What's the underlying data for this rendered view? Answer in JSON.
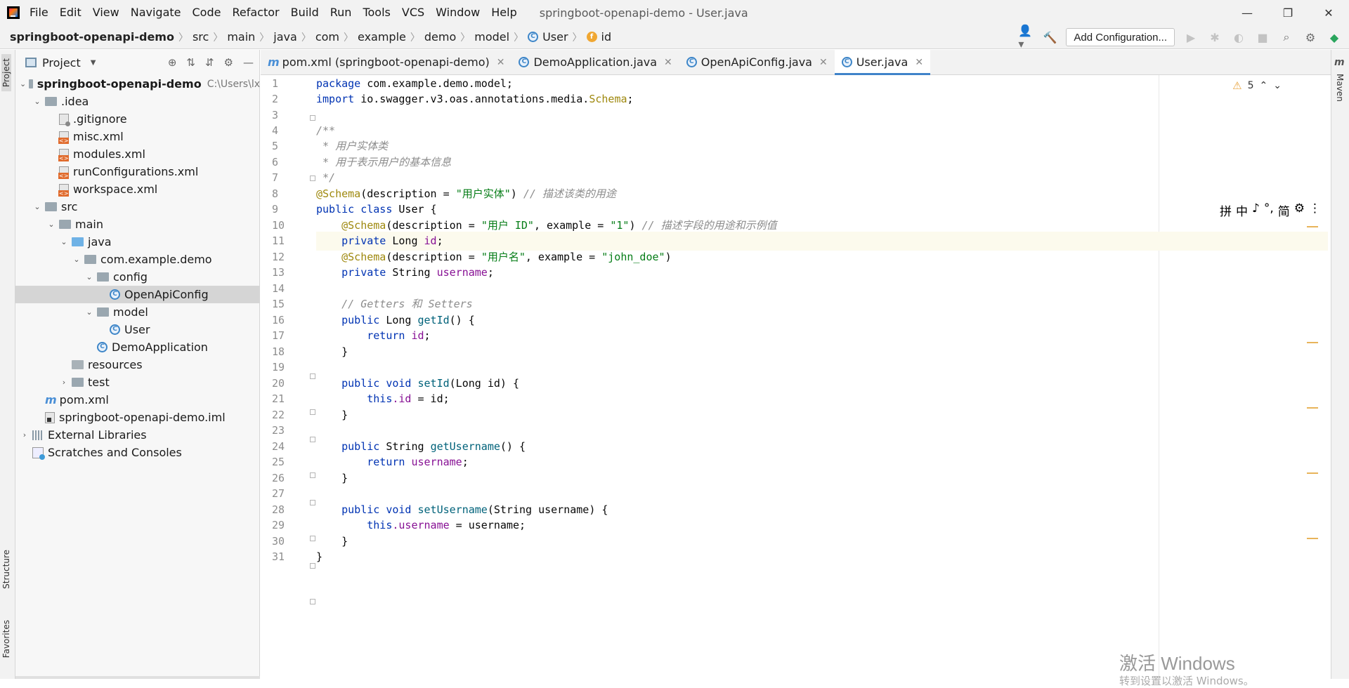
{
  "menu": [
    "File",
    "Edit",
    "View",
    "Navigate",
    "Code",
    "Refactor",
    "Build",
    "Run",
    "Tools",
    "VCS",
    "Window",
    "Help"
  ],
  "window_title": "springboot-openapi-demo - User.java",
  "breadcrumb": {
    "root": "springboot-openapi-demo",
    "parts": [
      "src",
      "main",
      "java",
      "com",
      "example",
      "demo",
      "model"
    ],
    "class": "User",
    "field": "id"
  },
  "toolbar": {
    "add_config": "Add Configuration..."
  },
  "project_panel": {
    "title": "Project",
    "root_name": "springboot-openapi-demo",
    "root_path": "C:\\Users\\lx",
    "tree": {
      "idea": ".idea",
      "gitignore": ".gitignore",
      "misc": "misc.xml",
      "modules": "modules.xml",
      "runconf": "runConfigurations.xml",
      "workspace": "workspace.xml",
      "src": "src",
      "main": "main",
      "java": "java",
      "pkg": "com.example.demo",
      "config": "config",
      "openapiconfig": "OpenApiConfig",
      "model": "model",
      "user": "User",
      "demoapp": "DemoApplication",
      "resources": "resources",
      "test": "test",
      "pom": "pom.xml",
      "iml": "springboot-openapi-demo.iml",
      "extlibs": "External Libraries",
      "scratches": "Scratches and Consoles"
    }
  },
  "tabs": [
    {
      "label": "pom.xml (springboot-openapi-demo)"
    },
    {
      "label": "DemoApplication.java"
    },
    {
      "label": "OpenApiConfig.java"
    },
    {
      "label": "User.java"
    }
  ],
  "editor": {
    "warnings": "5",
    "lines": [
      "1",
      "2",
      "3",
      "4",
      "5",
      "6",
      "7",
      "8",
      "9",
      "10",
      "11",
      "12",
      "13",
      "14",
      "15",
      "16",
      "17",
      "18",
      "19",
      "20",
      "21",
      "22",
      "23",
      "24",
      "25",
      "26",
      "27",
      "28",
      "29",
      "30",
      "31"
    ],
    "code": {
      "l1_kw": "package",
      "l1_rest": " com.example.demo.model;",
      "l2_kw": "import",
      "l2_rest": " io.swagger.v3.oas.annotations.media.",
      "l2_cls": "Schema",
      "l2_end": ";",
      "l4": "/**",
      "l5": " * 用户实体类",
      "l6": " * 用于表示用户的基本信息",
      "l7": " */",
      "l8_an": "@Schema",
      "l8_a": "(description = ",
      "l8_str": "\"用户实体\"",
      "l8_b": ") ",
      "l8_cm": "// 描述该类的用途",
      "l9_kw": "public class",
      "l9_name": " User",
      "l9_end": " {",
      "l10_an": "@Schema",
      "l10_a": "(description = ",
      "l10_str1": "\"用户 ID\"",
      "l10_b": ", example = ",
      "l10_str2": "\"1\"",
      "l10_c": ") ",
      "l10_cm": "// 描述字段的用途和示例值",
      "l11_kw": "private",
      "l11_type": " Long ",
      "l11_fld": "id",
      "l11_end": ";",
      "l12_an": "@Schema",
      "l12_a": "(description = ",
      "l12_str1": "\"用户名\"",
      "l12_b": ", example = ",
      "l12_str2": "\"john_doe\"",
      "l12_c": ")",
      "l13_kw": "private",
      "l13_type": " String ",
      "l13_fld": "username",
      "l13_end": ";",
      "l15_cm": "// Getters 和 Setters",
      "l16_kw": "public",
      "l16_type": " Long ",
      "l16_meth": "getId",
      "l16_end": "() {",
      "l17_kw": "return",
      "l17_fld": " id",
      "l17_end": ";",
      "l18": "}",
      "l20_kw": "public void",
      "l20_meth": " setId",
      "l20_end": "(Long id) {",
      "l21_kw": "this",
      "l21_fld": ".id",
      "l21_end": " = id;",
      "l22": "}",
      "l24_kw": "public",
      "l24_type": " String ",
      "l24_meth": "getUsername",
      "l24_end": "() {",
      "l25_kw": "return",
      "l25_fld": " username",
      "l25_end": ";",
      "l26": "}",
      "l28_kw": "public void",
      "l28_meth": " setUsername",
      "l28_end": "(String username) {",
      "l29_kw": "this",
      "l29_fld": ".username",
      "l29_end": " = username;",
      "l30": "}",
      "l31": "}"
    }
  },
  "ime_bar": [
    "拼",
    "中",
    "♪",
    "°,",
    "简",
    "⚙",
    "⋮"
  ],
  "side_tabs": {
    "project": "Project",
    "structure": "Structure",
    "favorites": "Favorites",
    "maven": "Maven"
  },
  "watermark": {
    "title": "激活 Windows",
    "sub": "转到设置以激活 Windows。"
  }
}
